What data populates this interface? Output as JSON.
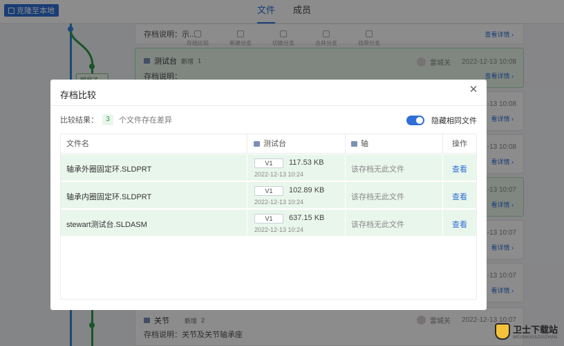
{
  "app": {
    "clone_button": "克隆至本地",
    "tabs": [
      {
        "label": "文件",
        "active": true
      },
      {
        "label": "成员",
        "active": false
      }
    ],
    "accent_color": "#2f6fd6",
    "branch_tag": "明显乙..."
  },
  "toolstrip": [
    {
      "label": "存档比较"
    },
    {
      "label": "新建分支"
    },
    {
      "label": "切换分支"
    },
    {
      "label": "合并分支"
    },
    {
      "label": "找带分支"
    }
  ],
  "background_cards": [
    {
      "sub": "存档说明：示...",
      "link": "查看详情 ›"
    },
    {
      "title": "测试台",
      "badge": "新增",
      "count": "1",
      "user": "雷城关",
      "time": "2022-12-13 10:08",
      "sub": "存档说明：",
      "link": "查看详情 ›"
    },
    {
      "time": "-12-13 10:08",
      "link": "看详情 ›"
    },
    {
      "time": "-12-13 10:08",
      "link": "看详情 ›"
    },
    {
      "time": "-12-13 10:07",
      "link": "看详情 ›"
    },
    {
      "time": "-12-13 10:07",
      "link": "看详情 ›"
    },
    {
      "time": "-12-13 10:07",
      "link": "看详情 ›"
    },
    {
      "title": "关节",
      "badge": "新增",
      "count": "2",
      "user": "雷城关",
      "time": "2022-12-13 10:07",
      "sub": "存档说明：关节及关节轴承座"
    }
  ],
  "modal": {
    "title": "存档比较",
    "close_icon": "close-icon",
    "result_label": "比较结果：",
    "result_count": "3",
    "result_note": "个文件存在差异",
    "toggle_label": "隐藏相同文件",
    "toggle_on": true,
    "table": {
      "headers": {
        "file": "文件名",
        "left": "测试台",
        "right": "轴",
        "action": "操作"
      },
      "rows": [
        {
          "name": "轴承外圈固定环.SLDPRT",
          "version": "V1",
          "size": "117.53 KB",
          "date": "2022-12-13 10:24",
          "right": "该存档无此文件",
          "action": "查看"
        },
        {
          "name": "轴承内圈固定环.SLDPRT",
          "version": "V1",
          "size": "102.89 KB",
          "date": "2022-12-13 10:24",
          "right": "该存档无此文件",
          "action": "查看"
        },
        {
          "name": "stewart测试台.SLDASM",
          "version": "V1",
          "size": "637.15 KB",
          "date": "2022-12-13 10:24",
          "right": "该存档无此文件",
          "action": "查看"
        }
      ]
    }
  },
  "watermark": {
    "title": "卫士下载站",
    "subtitle": "WEISHIXIAZAIZHAN"
  }
}
